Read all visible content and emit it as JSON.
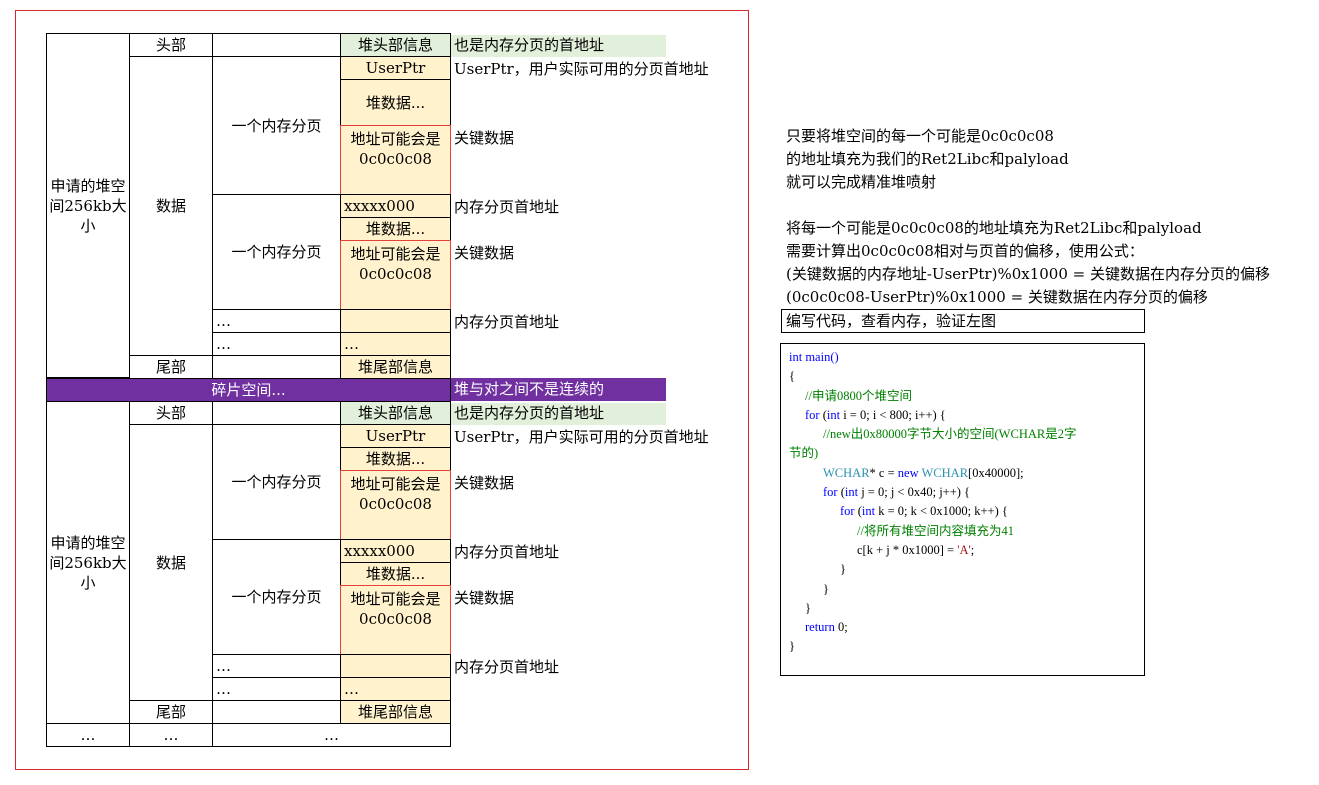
{
  "diagram": {
    "block": {
      "alloc_label": "申请的堆空间256kb大小",
      "head": "头部",
      "data": "数据",
      "tail": "尾部",
      "page": "一个内存分页",
      "heap_header": "堆头部信息",
      "userptr": "UserPtr",
      "heap_data": "堆数据...",
      "addr_maybe": "地址可能会是0c0c0c08",
      "xxxxx000": "xxxxx000",
      "ellipsis": "…",
      "heap_tail": "堆尾部信息",
      "note_header": "也是内存分页的首地址",
      "note_userptr": "UserPtr，用户实际可用的分页首地址",
      "note_key": "关键数据",
      "note_page_addr": "内存分页首地址"
    },
    "gap": {
      "label": "碎片空间...",
      "note": "堆与对之间不是连续的"
    },
    "bottom_ellipsis": "…"
  },
  "notes": {
    "line1": "只要将堆空间的每一个可能是0c0c0c08",
    "line2": "的地址填充为我们的Ret2Libc和palyload",
    "line3": "就可以完成精准堆喷射",
    "line4": "将每一个可能是0c0c0c08的地址填充为Ret2Libc和palyload",
    "line5": "需要计算出0c0c0c08相对与页首的偏移，使用公式：",
    "line6": "(关键数据的内存地址-UserPtr)%0x1000 = 关键数据在内存分页的偏移",
    "line7": "(0c0c0c08-UserPtr)%0x1000 = 关键数据在内存分页的偏移",
    "box": "编写代码，查看内存，验证左图"
  },
  "code": {
    "l1": "int main()",
    "l2": "{",
    "l3": "//申请0800个堆空间",
    "l4a": "for",
    "l4b": " (",
    "l4c": "int",
    "l4d": " i = 0; i < 800; i++) {",
    "l5": "//new出0x80000字节大小的空间(WCHAR是2字",
    "l5b": "节的)",
    "l6a": "WCHAR",
    "l6b": "* c = ",
    "l6c": "new",
    "l6d": " ",
    "l6e": "WCHAR",
    "l6f": "[0x40000];",
    "l7a": "for",
    "l7b": " (",
    "l7c": "int",
    "l7d": " j = 0; j < 0x40; j++) {",
    "l8a": "for",
    "l8b": " (",
    "l8c": "int",
    "l8d": " k = 0; k < 0x1000; k++) {",
    "l9": "//将所有堆空间内容填充为41",
    "l10a": "c[k + j * 0x1000] = ",
    "l10b": "'A'",
    "l10c": ";",
    "l11": "}",
    "l12": "}",
    "l13": "}",
    "l14a": "return",
    "l14b": " 0;",
    "l15": "}"
  }
}
